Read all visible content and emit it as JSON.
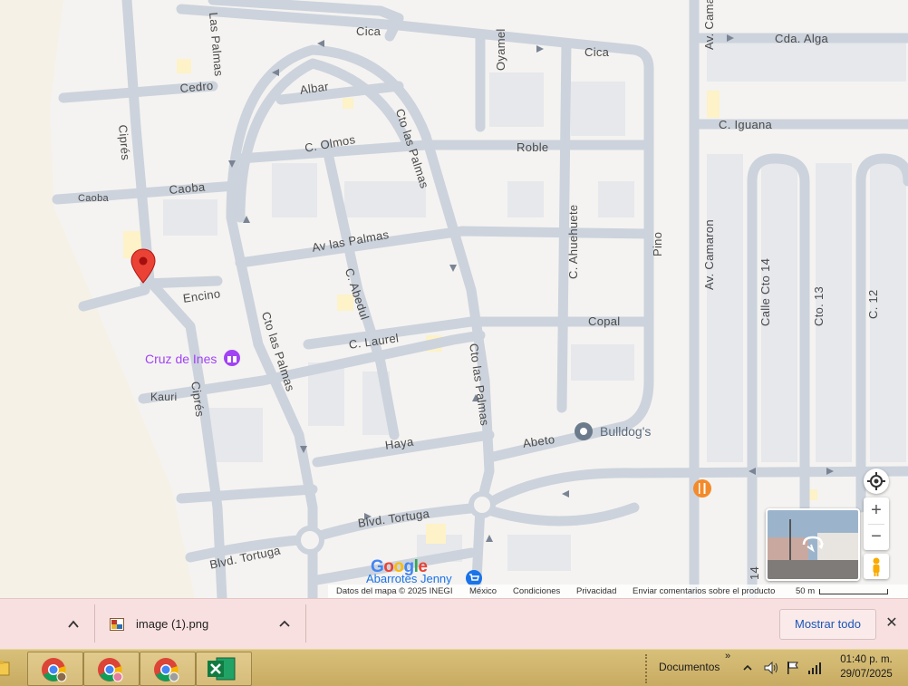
{
  "map": {
    "streets": {
      "cica_top": "Cica",
      "cica_right": "Cica",
      "cda_alga": "Cda. Alga",
      "las_palmas_top": "Las Palmas",
      "cedro": "Cedro",
      "albar": "Albar",
      "oyamel": "Oyamel",
      "cto_las_palmas_1": "Cto las Palmas",
      "av_camaron_top": "Av. Camar",
      "c_iguana": "C. Iguana",
      "cipres_1": "Ciprés",
      "c_olmos": "C. Olmos",
      "roble": "Roble",
      "caoba_left": "Caoba",
      "caoba": "Caoba",
      "av_camaron": "Av. Camaron",
      "c_ahuehuete": "C. Ahuehuete",
      "pino": "Pino",
      "av_las_palmas": "Av las Palmas",
      "calle_cto_14": "Calle Cto 14",
      "cto_13": "Cto. 13",
      "c_12": "C. 12",
      "encino": "Encino",
      "c_abedul": "C. Abedul",
      "cto_las_palmas_2": "Cto las Palmas",
      "copal": "Copal",
      "c_laurel": "C. Laurel",
      "cto_las_palmas_3": "Cto las Palmas",
      "kauri": "Kauri",
      "cipres_2": "Ciprés",
      "haya": "Haya",
      "abeto": "Abeto",
      "blvd_tortuga_1": "Blvd. Tortuga",
      "blvd_tortuga_2": "Blvd. Tortuga",
      "num_14": "14"
    },
    "pois": {
      "cruz_de_ines": "Cruz de Ines",
      "bulldogs": "Bulldog's",
      "abarrotes_jenny": "Abarrotes Jenny"
    },
    "google_logo": "Google",
    "footer": {
      "datos": "Datos del mapa © 2025 INEGI",
      "mexico": "México",
      "condiciones": "Condiciones",
      "privacidad": "Privacidad",
      "comentarios": "Enviar comentarios sobre el producto",
      "scale": "50 m"
    },
    "controls": {
      "zoom_in": "+",
      "zoom_out": "−"
    }
  },
  "download_bar": {
    "file_name": "image (1).png",
    "show_all": "Mostrar todo",
    "close": "✕"
  },
  "taskbar": {
    "documentos": "Documentos",
    "time": "01:40 p. m.",
    "date": "29/07/2025"
  }
}
